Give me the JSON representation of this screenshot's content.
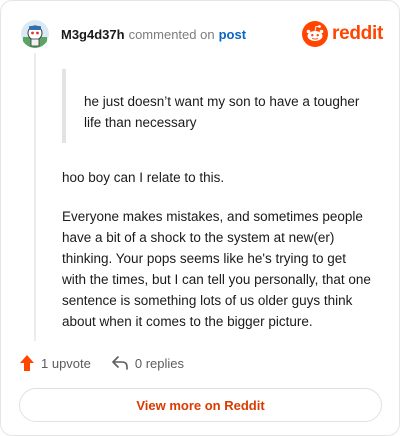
{
  "header": {
    "username": "M3g4d37h",
    "commented_text": "commented on",
    "post_link": "post",
    "brand_name": "reddit"
  },
  "comment": {
    "quote": "he just doesn’t want my son to have a tougher life than necessary",
    "paragraphs": [
      "hoo boy can I relate to this.",
      "Everyone makes mistakes, and sometimes people have a bit of a shock to the system at new(er) thinking. Your pops seems like he's trying to get with the times, but I can tell you personally, that one sentence is something lots of us older guys think about when it comes to the bigger picture."
    ]
  },
  "actions": {
    "upvote_label": "1 upvote",
    "replies_label": "0 replies"
  },
  "cta": {
    "view_more_label": "View more on Reddit"
  },
  "colors": {
    "brand": "#ff4500",
    "link": "#0a66c2",
    "cta_text": "#d93a00"
  },
  "icons": {
    "avatar": "snoo-avatar",
    "brand": "reddit-logo-icon",
    "upvote": "upvote-arrow-icon",
    "reply": "reply-arrow-icon"
  }
}
